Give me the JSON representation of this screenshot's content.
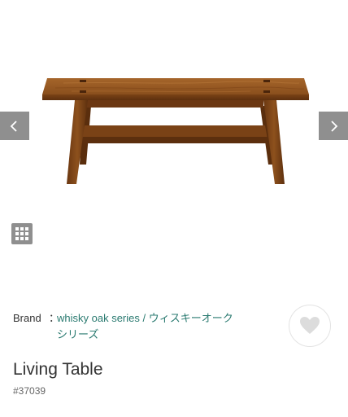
{
  "gallery": {
    "prev_icon": "chevron-left-icon",
    "next_icon": "chevron-right-icon",
    "grid_icon": "grid-icon",
    "control_color": "#8f8f8f"
  },
  "brand": {
    "label": "Brand",
    "separator": "：",
    "name": "whisky oak series / ウィスキーオーク\nシリーズ",
    "link_color": "#2a7a70"
  },
  "favorite": {
    "icon": "heart-icon",
    "icon_color": "#dcdcdc"
  },
  "product": {
    "title": "Living Table",
    "code": "#37039"
  }
}
